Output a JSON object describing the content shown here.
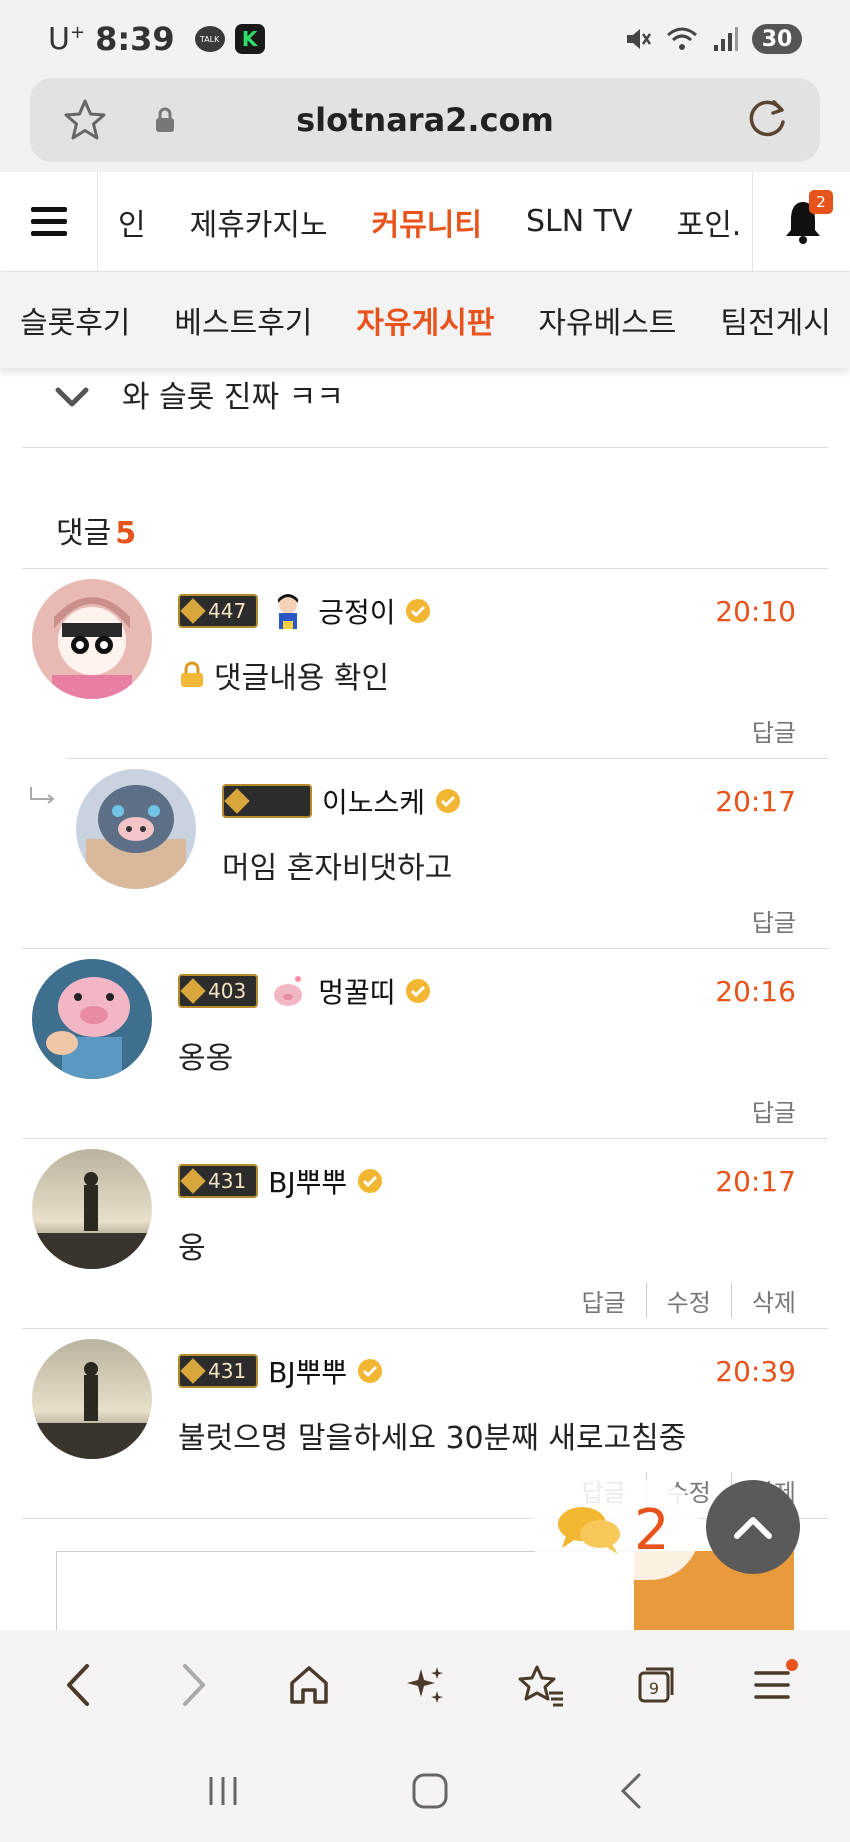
{
  "status_bar": {
    "carrier": "U",
    "carrier_sup": "+",
    "time": "8:39",
    "talk_label": "TALK",
    "k_label": "K",
    "battery": "30"
  },
  "url_bar": {
    "url": "slotnara2.com"
  },
  "site_nav": {
    "items": [
      "인",
      "제휴카지노",
      "커뮤니티",
      "SLN TV",
      "포인."
    ],
    "active_index": 2,
    "bell_badge": "2"
  },
  "sub_nav": {
    "items": [
      "슬롯후기",
      "베스트후기",
      "자유게시판",
      "자유베스트",
      "팀전게시"
    ],
    "active_index": 2
  },
  "related_post": {
    "title": "와 슬롯 진짜 ㅋㅋ"
  },
  "comments_header": {
    "label": "댓글",
    "count": "5"
  },
  "comments": [
    {
      "level": "447",
      "nickname": "긍정이",
      "time": "20:10",
      "body": "댓글내용 확인",
      "locked": true,
      "actions": [
        "답글"
      ],
      "reply": false,
      "avatar_color": "#e9b9b4"
    },
    {
      "level": "",
      "nickname": "이노스케",
      "time": "20:17",
      "body": "머임 혼자비댓하고",
      "locked": false,
      "actions": [
        "답글"
      ],
      "reply": true,
      "avatar_color": "#7f8fa6"
    },
    {
      "level": "403",
      "nickname": "멍꿀띠",
      "time": "20:16",
      "body": "옹옹",
      "locked": false,
      "actions": [
        "답글"
      ],
      "reply": false,
      "avatar_color": "#f3b6c4"
    },
    {
      "level": "431",
      "nickname": "BJ뿌뿌",
      "time": "20:17",
      "body": "웅",
      "locked": false,
      "actions": [
        "답글",
        "수정",
        "삭제"
      ],
      "reply": false,
      "avatar_color": "#8a8575"
    },
    {
      "level": "431",
      "nickname": "BJ뿌뿌",
      "time": "20:39",
      "body": "불럿으명 말을하세요 30분째 새로고침중",
      "locked": false,
      "actions": [
        "답글",
        "수정",
        "삭제"
      ],
      "reply": false,
      "avatar_color": "#8a8575"
    }
  ],
  "floating": {
    "comment_count": "2"
  },
  "browser_bar": {
    "tabs_count": "9"
  },
  "colors": {
    "accent": "#e8531c",
    "submit": "#e89a3c"
  }
}
